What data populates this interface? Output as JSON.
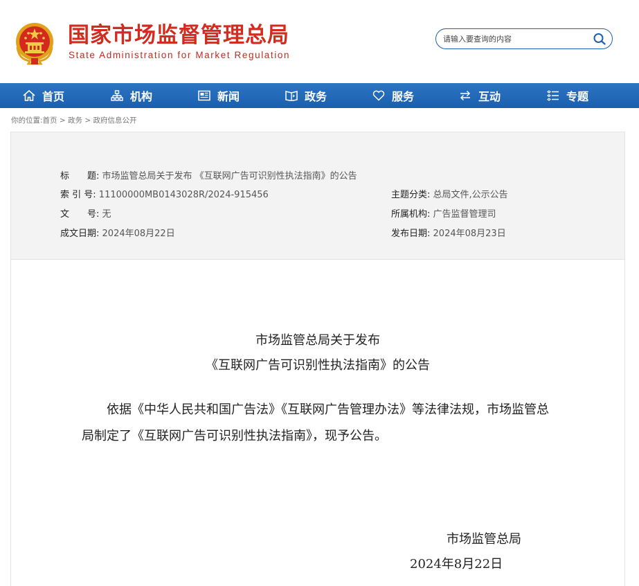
{
  "header": {
    "title_cn": "国家市场监督管理总局",
    "title_en": "State Administration for Market Regulation",
    "emblem_icon": "national-emblem-icon",
    "search": {
      "placeholder": "请输入要查询的内容",
      "value": ""
    }
  },
  "nav": {
    "items": [
      {
        "label": "首页",
        "icon": "home-icon"
      },
      {
        "label": "机构",
        "icon": "org-chart-icon"
      },
      {
        "label": "新闻",
        "icon": "news-icon"
      },
      {
        "label": "政务",
        "icon": "book-icon"
      },
      {
        "label": "服务",
        "icon": "heart-icon"
      },
      {
        "label": "互动",
        "icon": "swap-arrows-icon"
      },
      {
        "label": "专题",
        "icon": "list-icon"
      }
    ],
    "background": "#1f66b5"
  },
  "breadcrumb": {
    "prefix": "你的位置:",
    "items": [
      "首页",
      "政务",
      "政府信息公开"
    ],
    "separator": ">"
  },
  "meta": {
    "title_label": "标　　题:",
    "title_value": "市场监管总局关于发布 《互联网广告可识别性执法指南》的公告",
    "index_label": "索 引 号:",
    "index_value": "11100000MB0143028R/2024-915456",
    "topic_label": "主题分类:",
    "topic_value": "总局文件,公示公告",
    "docno_label": "文　　号:",
    "docno_value": "无",
    "org_label": "所属机构:",
    "org_value": "广告监督管理司",
    "created_label": "成文日期:",
    "created_value": "2024年08月22日",
    "published_label": "发布日期:",
    "published_value": "2024年08月23日"
  },
  "article": {
    "title_line1": "市场监管总局关于发布",
    "title_line2": "《互联网广告可识别性执法指南》的公告",
    "body": "依据《中华人民共和国广告法》《互联网广告管理办法》等法律法规，市场监管总局制定了《互联网广告可识别性执法指南》，现予公告。",
    "signature_org": "市场监管总局",
    "signature_date": "2024年8月22日"
  },
  "colors": {
    "brand_red": "#d22b1f",
    "nav_blue": "#1f66b5"
  }
}
